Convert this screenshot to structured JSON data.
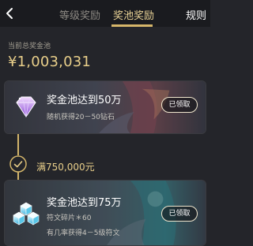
{
  "header": {
    "back_icon": "chevron-left-icon",
    "tabs": [
      {
        "label": "等级奖励",
        "active": false
      },
      {
        "label": "奖池奖励",
        "active": true
      }
    ],
    "rules_label": "规则"
  },
  "pool": {
    "label": "当前总奖金池",
    "amount": "¥1,003,031"
  },
  "rewards": [
    {
      "title": "奖金池达到50万",
      "desc": [
        "随机获得20－50钻石"
      ],
      "button": "已领取",
      "icon": "diamond-icon"
    },
    {
      "title": "奖金池达到75万",
      "desc": [
        "符文碎片＊60",
        "有几率获得4－5级符文"
      ],
      "button": "已领取",
      "icon": "rune-crystals-icon"
    }
  ],
  "milestone": {
    "text": "满750,000元",
    "icon": "check-circle-icon"
  },
  "colors": {
    "background": "#24252a",
    "topbar": "#1a1b1f",
    "gold": "#e9cf8a",
    "accent_line": "#d6b66a"
  }
}
